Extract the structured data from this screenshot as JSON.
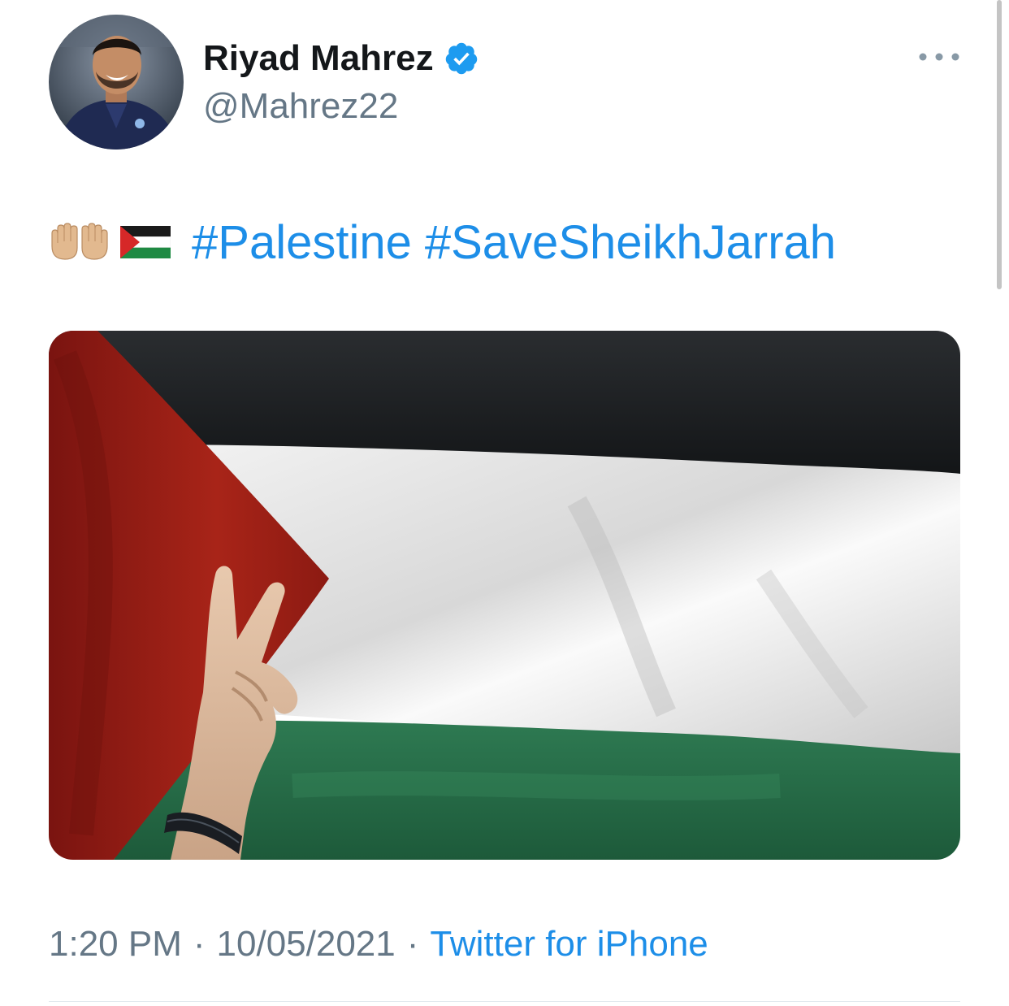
{
  "author": {
    "display_name": "Riyad Mahrez",
    "handle": "@Mahrez22",
    "verified": true,
    "avatar_icon": "profile-photo"
  },
  "tweet": {
    "emojis": [
      "open-hands-emoji",
      "palestine-flag-emoji"
    ],
    "hashtags": [
      "#Palestine",
      "#SaveSheikhJarrah"
    ],
    "media_icon": "photo-palestinian-flag-peace-sign"
  },
  "meta": {
    "time": "1:20 PM",
    "separator": "·",
    "date": "10/05/2021",
    "source": "Twitter for iPhone"
  },
  "colors": {
    "link": "#1d8ee8",
    "muted": "#657786",
    "verified": "#1d9bf0"
  }
}
